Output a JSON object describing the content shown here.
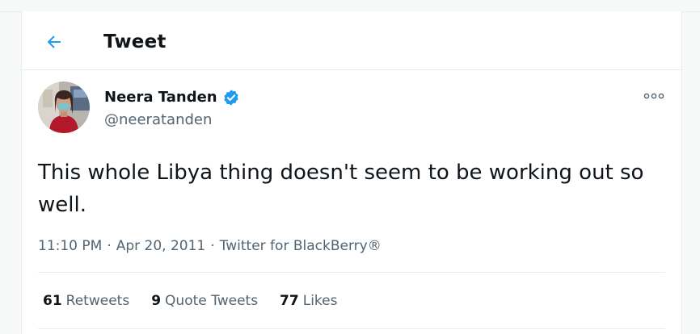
{
  "header": {
    "title": "Tweet",
    "back_icon": "arrow-left-icon"
  },
  "author": {
    "display_name": "Neera Tanden",
    "handle": "@neeratanden",
    "verified": true,
    "verified_icon": "verified-badge-icon",
    "avatar_icon": "avatar-photo"
  },
  "tweet": {
    "text": "This whole Libya thing doesn't seem to be working out so well.",
    "time": "11:10 PM",
    "date": "Apr 20, 2011",
    "source": "Twitter for BlackBerry®",
    "separator": "·"
  },
  "stats": {
    "retweets_count": "61",
    "retweets_label": "Retweets",
    "quotes_count": "9",
    "quotes_label": "Quote Tweets",
    "likes_count": "77",
    "likes_label": "Likes"
  },
  "more_icon": "more-options-icon",
  "colors": {
    "accent": "#1d9bf0",
    "text_primary": "#0f1419",
    "text_secondary": "#536471",
    "border": "#e6ecf0"
  }
}
